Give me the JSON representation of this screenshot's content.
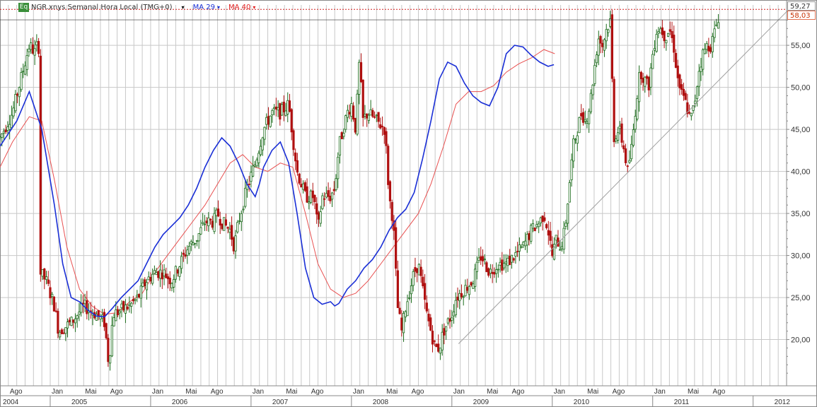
{
  "legend": {
    "icon": "Eq",
    "title": "NGR.xnys Semanal Hora Local (TMG+0)",
    "ma1": "MA 29",
    "ma2": "MA 40"
  },
  "price_tags": {
    "last": "59,27",
    "ma": "58,03"
  },
  "colors": {
    "ma1": "#1a2fd6",
    "ma2": "#e85050",
    "candle_up": "#1a6b1a",
    "candle_down": "#b01010",
    "trendline": "#a0a0a0",
    "grid": "#c8c8c8",
    "last_price_line": "#d02020"
  },
  "chart_data": {
    "type": "candlestick",
    "title": "NGR.xnys Semanal Hora Local (TMG+0)",
    "ylim": [
      14.5,
      59.8
    ],
    "y_ticks": [
      "20,00",
      "25,00",
      "30,00",
      "35,00",
      "40,00",
      "45,00",
      "50,00",
      "55,00"
    ],
    "y_tick_values": [
      20,
      25,
      30,
      35,
      40,
      45,
      50,
      55
    ],
    "x_range_months": [
      7,
      101
    ],
    "month_labels": [
      {
        "m": 8,
        "t": "Ago"
      },
      {
        "m": 13,
        "t": "Jan"
      },
      {
        "m": 17,
        "t": "Mai"
      },
      {
        "m": 20,
        "t": "Ago"
      },
      {
        "m": 25,
        "t": "Jan"
      },
      {
        "m": 29,
        "t": "Mai"
      },
      {
        "m": 32,
        "t": "Ago"
      },
      {
        "m": 37,
        "t": "Jan"
      },
      {
        "m": 41,
        "t": "Mai"
      },
      {
        "m": 44,
        "t": "Ago"
      },
      {
        "m": 49,
        "t": "Jan"
      },
      {
        "m": 53,
        "t": "Mai"
      },
      {
        "m": 56,
        "t": "Ago"
      },
      {
        "m": 61,
        "t": "Jan"
      },
      {
        "m": 65,
        "t": "Mai"
      },
      {
        "m": 68,
        "t": "Ago"
      },
      {
        "m": 73,
        "t": "Jan"
      },
      {
        "m": 77,
        "t": "Mai"
      },
      {
        "m": 80,
        "t": "Ago"
      },
      {
        "m": 85,
        "t": "Jan"
      },
      {
        "m": 89,
        "t": "Mai"
      },
      {
        "m": 92,
        "t": "Ago"
      }
    ],
    "year_labels": [
      {
        "m": 7,
        "t": "2004"
      },
      {
        "m": 13,
        "t": "2005"
      },
      {
        "m": 25,
        "t": "2006"
      },
      {
        "m": 37,
        "t": "2007"
      },
      {
        "m": 49,
        "t": "2008"
      },
      {
        "m": 61,
        "t": "2009"
      },
      {
        "m": 73,
        "t": "2010"
      },
      {
        "m": 85,
        "t": "2011"
      },
      {
        "m": 97,
        "t": "2012"
      }
    ],
    "price_path": [
      [
        7,
        44
      ],
      [
        8.5,
        47
      ],
      [
        9.5,
        51
      ],
      [
        10.5,
        55
      ],
      [
        11.3,
        54
      ],
      [
        11.6,
        57
      ],
      [
        11.8,
        28
      ],
      [
        12.5,
        27
      ],
      [
        13.5,
        24
      ],
      [
        14,
        21
      ],
      [
        15.5,
        22
      ],
      [
        17,
        24
      ],
      [
        18.5,
        23
      ],
      [
        19.5,
        22
      ],
      [
        20,
        17
      ],
      [
        20.5,
        23
      ],
      [
        21.5,
        23.5
      ],
      [
        22.5,
        24
      ],
      [
        23.5,
        25
      ],
      [
        24.5,
        27
      ],
      [
        25.5,
        28
      ],
      [
        26.5,
        28
      ],
      [
        27.5,
        27
      ],
      [
        28.5,
        29
      ],
      [
        29.5,
        31
      ],
      [
        30.5,
        32
      ],
      [
        31.5,
        34
      ],
      [
        32.5,
        34
      ],
      [
        33,
        35
      ],
      [
        33.5,
        34
      ],
      [
        34.5,
        33
      ],
      [
        35,
        31
      ],
      [
        35.5,
        34
      ],
      [
        36.5,
        38
      ],
      [
        37.5,
        41
      ],
      [
        38.5,
        45
      ],
      [
        39.5,
        47
      ],
      [
        40.5,
        47
      ],
      [
        41.5,
        48
      ],
      [
        42,
        44
      ],
      [
        42.5,
        40
      ],
      [
        43.5,
        37
      ],
      [
        44.5,
        37
      ],
      [
        45,
        33
      ],
      [
        45.5,
        37
      ],
      [
        46.5,
        37
      ],
      [
        47,
        38
      ],
      [
        47.5,
        43
      ],
      [
        48.5,
        47
      ],
      [
        49,
        48
      ],
      [
        49.5,
        45
      ],
      [
        50,
        54
      ],
      [
        50.3,
        46
      ],
      [
        51,
        47
      ],
      [
        52,
        46
      ],
      [
        53,
        45
      ],
      [
        53.5,
        37
      ],
      [
        54,
        34
      ],
      [
        54.5,
        24
      ],
      [
        55,
        21
      ],
      [
        55.5,
        24
      ],
      [
        56,
        26
      ],
      [
        56.5,
        28
      ],
      [
        57,
        29
      ],
      [
        57.5,
        26
      ],
      [
        58,
        23
      ],
      [
        58.5,
        21
      ],
      [
        59,
        19
      ],
      [
        59.5,
        19
      ],
      [
        60,
        21
      ],
      [
        60.5,
        22
      ],
      [
        61,
        23
      ],
      [
        61.5,
        25
      ],
      [
        62.5,
        26
      ],
      [
        63.5,
        27
      ],
      [
        64.5,
        30
      ],
      [
        65,
        29
      ],
      [
        65.5,
        28
      ],
      [
        66.5,
        29
      ],
      [
        67.5,
        29
      ],
      [
        68.5,
        30
      ],
      [
        69.5,
        31
      ],
      [
        70.5,
        33
      ],
      [
        71.5,
        34
      ],
      [
        72,
        35
      ],
      [
        72.5,
        33
      ],
      [
        73,
        30
      ],
      [
        73.5,
        32
      ],
      [
        74,
        31
      ],
      [
        74.5,
        33
      ],
      [
        75,
        38
      ],
      [
        75.5,
        43
      ],
      [
        76,
        45
      ],
      [
        76.5,
        47
      ],
      [
        77,
        46
      ],
      [
        77.5,
        48
      ],
      [
        78,
        52
      ],
      [
        78.5,
        56
      ],
      [
        79,
        55
      ],
      [
        79.5,
        57
      ],
      [
        80,
        58
      ],
      [
        80.3,
        44
      ],
      [
        81,
        45
      ],
      [
        81.5,
        43
      ],
      [
        82,
        40
      ],
      [
        82.5,
        43
      ],
      [
        83,
        48
      ],
      [
        83.5,
        52
      ],
      [
        84,
        51
      ],
      [
        84.5,
        50
      ],
      [
        85,
        54
      ],
      [
        85.5,
        57
      ],
      [
        86,
        57
      ],
      [
        86.5,
        56
      ],
      [
        87,
        57
      ],
      [
        87.5,
        55
      ],
      [
        88,
        51
      ],
      [
        88.5,
        49
      ],
      [
        89,
        48
      ],
      [
        89.5,
        46
      ],
      [
        90,
        48
      ],
      [
        90.5,
        52
      ],
      [
        91,
        54
      ],
      [
        91.5,
        55
      ],
      [
        92,
        55
      ],
      [
        92.5,
        57
      ],
      [
        93,
        59
      ]
    ],
    "series": [
      {
        "name": "MA 29",
        "values": [
          [
            7,
            43
          ],
          [
            9,
            46
          ],
          [
            10.5,
            49.5
          ],
          [
            12,
            45
          ],
          [
            13.5,
            36
          ],
          [
            14.5,
            29
          ],
          [
            15.5,
            25
          ],
          [
            16.5,
            24.5
          ],
          [
            17.5,
            23.5
          ],
          [
            18.5,
            22.8
          ],
          [
            19.5,
            22.7
          ],
          [
            20.5,
            23.8
          ],
          [
            21.5,
            25
          ],
          [
            22.5,
            26
          ],
          [
            23.5,
            27
          ],
          [
            24.5,
            29
          ],
          [
            25.5,
            31
          ],
          [
            26.5,
            32.5
          ],
          [
            27.5,
            33.5
          ],
          [
            28.5,
            34.5
          ],
          [
            29.5,
            36
          ],
          [
            30.5,
            38
          ],
          [
            31.5,
            40.5
          ],
          [
            32.5,
            42.5
          ],
          [
            33.5,
            44
          ],
          [
            34.5,
            43
          ],
          [
            35.5,
            41
          ],
          [
            36.5,
            38.5
          ],
          [
            37.5,
            37
          ],
          [
            38,
            38.5
          ],
          [
            38.5,
            40.5
          ],
          [
            39.5,
            42.5
          ],
          [
            40.5,
            43.5
          ],
          [
            41.5,
            41
          ],
          [
            42.5,
            35
          ],
          [
            43.5,
            28.5
          ],
          [
            44.5,
            25
          ],
          [
            45.5,
            24.2
          ],
          [
            46.5,
            24.5
          ],
          [
            47,
            24
          ],
          [
            47.5,
            24.3
          ],
          [
            48.5,
            26
          ],
          [
            49.5,
            27
          ],
          [
            50.5,
            28.5
          ],
          [
            51.5,
            29.5
          ],
          [
            52.5,
            31
          ],
          [
            53.5,
            33
          ],
          [
            54.5,
            34.5
          ],
          [
            55.5,
            35.5
          ],
          [
            56.5,
            37.5
          ],
          [
            57.5,
            41.5
          ],
          [
            58.5,
            46
          ],
          [
            59.5,
            51
          ],
          [
            60.5,
            53
          ],
          [
            61.5,
            52.5
          ],
          [
            62.5,
            50.5
          ],
          [
            63.5,
            49
          ],
          [
            64.5,
            48.2
          ],
          [
            65.5,
            47.8
          ],
          [
            66.5,
            50
          ],
          [
            67.5,
            54
          ],
          [
            68.5,
            55
          ],
          [
            69.5,
            54.8
          ],
          [
            70.5,
            53.8
          ],
          [
            71.5,
            53
          ],
          [
            72.5,
            52.5
          ],
          [
            73.2,
            52.7
          ]
        ]
      },
      {
        "name": "MA 40",
        "values": [
          [
            7,
            40.5
          ],
          [
            8.5,
            43.5
          ],
          [
            10.5,
            46.5
          ],
          [
            12,
            46
          ],
          [
            13.5,
            39
          ],
          [
            15,
            31
          ],
          [
            16.5,
            26
          ],
          [
            18,
            24
          ],
          [
            19.5,
            23
          ],
          [
            21,
            23.2
          ],
          [
            22.5,
            24.5
          ],
          [
            24,
            25.5
          ],
          [
            25.5,
            28
          ],
          [
            27,
            30
          ],
          [
            28.5,
            32
          ],
          [
            30,
            34
          ],
          [
            31.5,
            36
          ],
          [
            33,
            38.5
          ],
          [
            34.5,
            41
          ],
          [
            36,
            42
          ],
          [
            37.5,
            40.5
          ],
          [
            39,
            40
          ],
          [
            40.5,
            41
          ],
          [
            42,
            40.5
          ],
          [
            43.5,
            35
          ],
          [
            45,
            29
          ],
          [
            46.5,
            26
          ],
          [
            48,
            25
          ],
          [
            49.5,
            25.5
          ],
          [
            51,
            27
          ],
          [
            52.5,
            29
          ],
          [
            54,
            31
          ],
          [
            55.5,
            33
          ],
          [
            57,
            35
          ],
          [
            58.5,
            38.5
          ],
          [
            60,
            43
          ],
          [
            61.5,
            48
          ],
          [
            63,
            49.5
          ],
          [
            64.5,
            49.5
          ],
          [
            66,
            50.2
          ],
          [
            67.5,
            51.8
          ],
          [
            69,
            52.8
          ],
          [
            70.5,
            53.5
          ],
          [
            72,
            54.5
          ],
          [
            73.3,
            54
          ]
        ]
      }
    ],
    "trendline": [
      [
        61.8,
        19.5
      ],
      [
        101.5,
        59.5
      ]
    ],
    "last_price": 59.27,
    "ma_value": 58.03
  }
}
